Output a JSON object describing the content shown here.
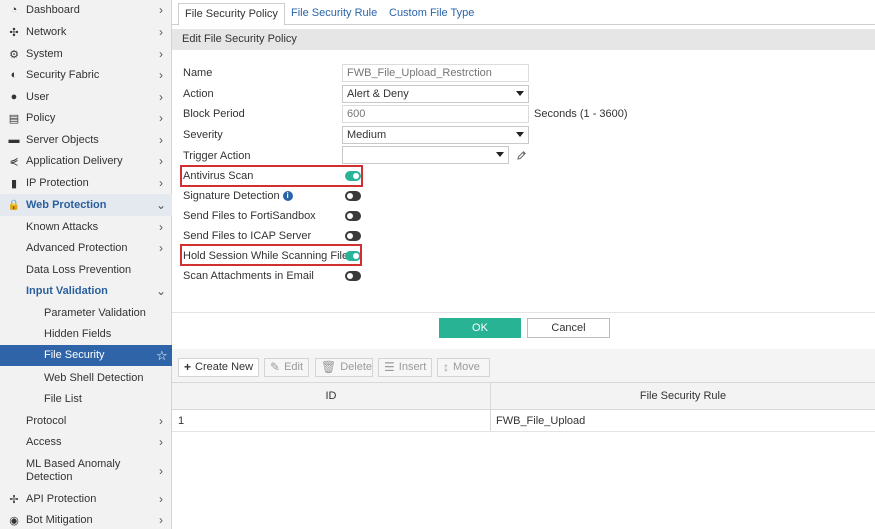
{
  "sidebar": {
    "items": [
      {
        "label": "Dashboard",
        "icon": "dashboard-icon",
        "glyph": "◔",
        "chevron": "›"
      },
      {
        "label": "Network",
        "icon": "network-icon",
        "glyph": "✣",
        "chevron": "›"
      },
      {
        "label": "System",
        "icon": "gear-icon",
        "glyph": "⚙",
        "chevron": "›"
      },
      {
        "label": "Security Fabric",
        "icon": "fabric-icon",
        "glyph": "◐",
        "chevron": "›"
      },
      {
        "label": "User",
        "icon": "user-icon",
        "glyph": "●",
        "chevron": "›"
      },
      {
        "label": "Policy",
        "icon": "policy-icon",
        "glyph": "▤",
        "chevron": "›"
      },
      {
        "label": "Server Objects",
        "icon": "server-icon",
        "glyph": "▬",
        "chevron": "›"
      },
      {
        "label": "Application Delivery",
        "icon": "delivery-icon",
        "glyph": "⋞",
        "chevron": "›"
      },
      {
        "label": "IP Protection",
        "icon": "ip-protection-icon",
        "glyph": "▮",
        "chevron": "›"
      },
      {
        "label": "Web Protection",
        "icon": "lock-icon",
        "glyph": "🔒",
        "chevron": "⌄"
      },
      {
        "label": "Known Attacks",
        "chevron": "›"
      },
      {
        "label": "Advanced Protection",
        "chevron": "›"
      },
      {
        "label": "Data Loss Prevention",
        "chevron": ""
      },
      {
        "label": "Input Validation",
        "chevron": "⌄"
      },
      {
        "label": "Parameter Validation",
        "chevron": ""
      },
      {
        "label": "Hidden Fields",
        "chevron": ""
      },
      {
        "label": "File Security",
        "chevron": "☆"
      },
      {
        "label": "Web Shell Detection",
        "chevron": ""
      },
      {
        "label": "File List",
        "chevron": ""
      },
      {
        "label": "Protocol",
        "chevron": "›"
      },
      {
        "label": "Access",
        "chevron": "›"
      },
      {
        "label": "ML Based Anomaly Detection",
        "chevron": "›"
      },
      {
        "label": "API Protection",
        "icon": "api-icon",
        "glyph": "✢",
        "chevron": "›"
      },
      {
        "label": "Bot Mitigation",
        "icon": "bot-icon",
        "glyph": "◉",
        "chevron": "›"
      }
    ]
  },
  "tabs": [
    "File Security Policy",
    "File Security Rule",
    "Custom File Type"
  ],
  "form": {
    "header": "Edit File Security Policy",
    "name_label": "Name",
    "name_placeholder": "FWB_File_Upload_Restrction",
    "action_label": "Action",
    "action_value": "Alert & Deny",
    "block_period_label": "Block Period",
    "block_period_placeholder": "600",
    "block_period_hint": "Seconds (1 - 3600)",
    "severity_label": "Severity",
    "severity_value": "Medium",
    "trigger_action_label": "Trigger Action",
    "trigger_action_value": "",
    "toggles": [
      {
        "label": "Antivirus Scan",
        "on": true
      },
      {
        "label": "Signature Detection",
        "on": false
      },
      {
        "label": "Send Files to FortiSandbox",
        "on": false
      },
      {
        "label": "Send Files to ICAP Server",
        "on": false
      },
      {
        "label": "Hold Session While Scanning File",
        "on": true
      },
      {
        "label": "Scan Attachments in Email",
        "on": false
      }
    ],
    "info_glyph": "i",
    "ok_label": "OK",
    "cancel_label": "Cancel"
  },
  "toolbar": {
    "create_new": "Create New",
    "edit": "Edit",
    "delete": "Delete",
    "insert": "Insert",
    "move": "Move"
  },
  "table": {
    "columns": [
      "ID",
      "File Security Rule"
    ],
    "rows": [
      {
        "id": "1",
        "rule": "FWB_File_Upload"
      }
    ]
  },
  "colors": {
    "accent": "#2f64a8",
    "toggle_on": "#2bb39a",
    "ok_button": "#28b394",
    "highlight": "#d23030"
  }
}
